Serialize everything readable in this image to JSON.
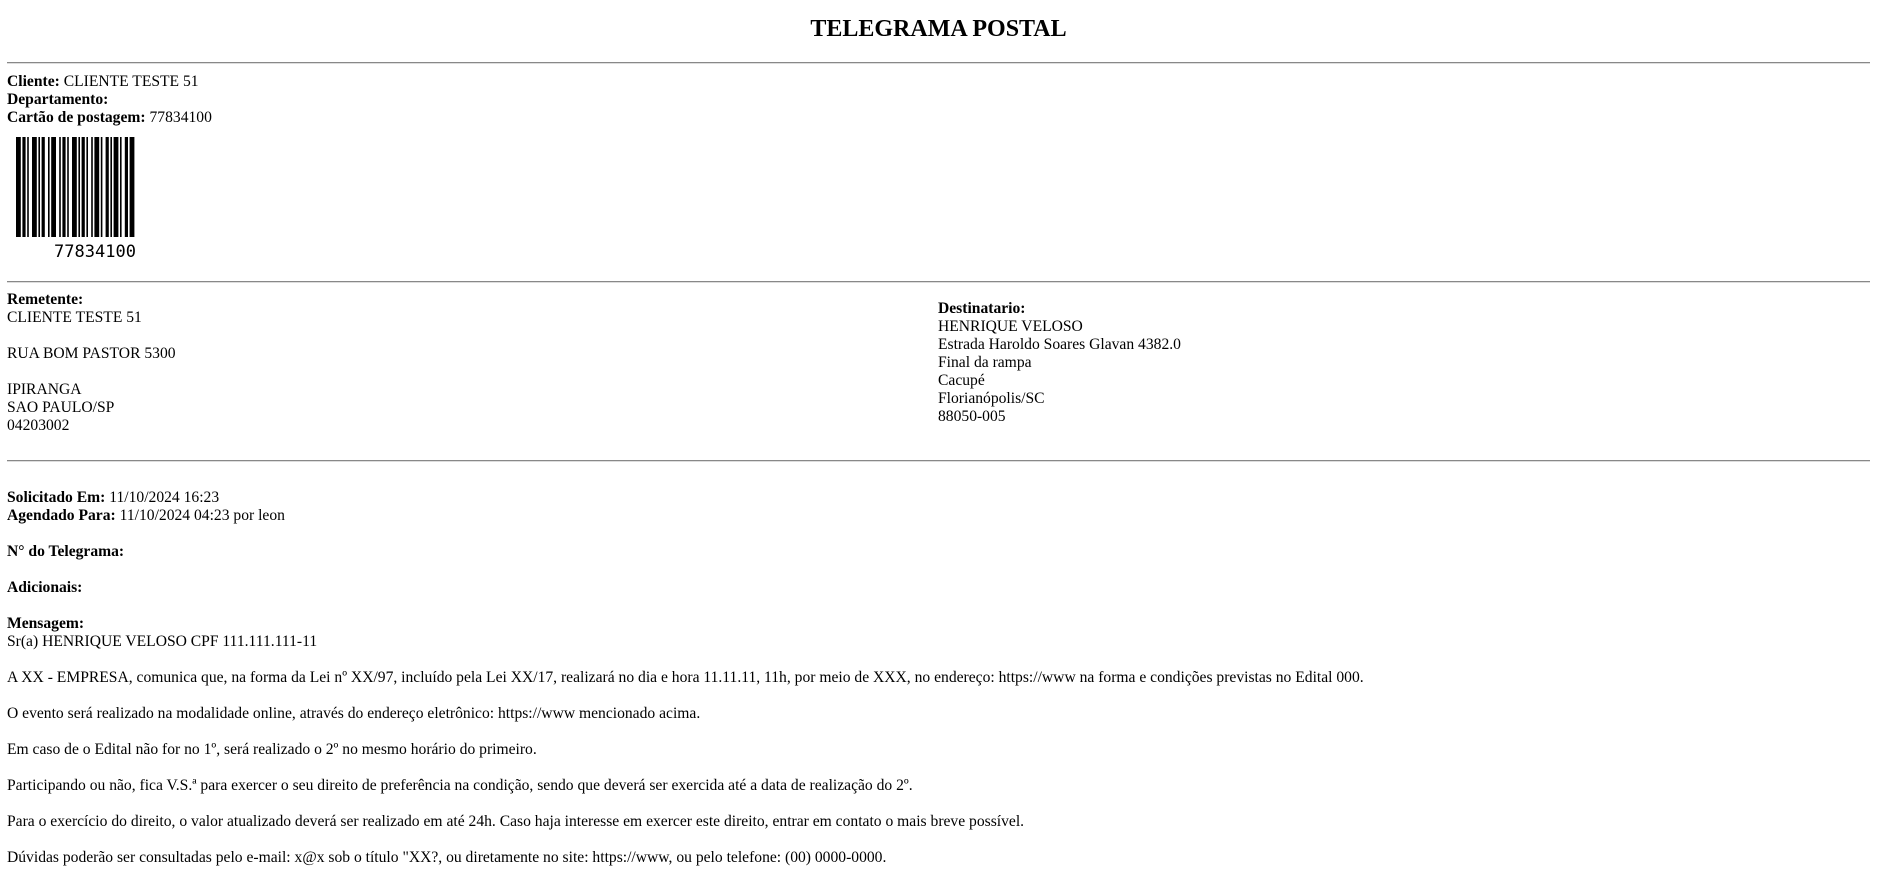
{
  "title": "TELEGRAMA POSTAL",
  "client": {
    "cliente_label": "Cliente:",
    "cliente_value": "CLIENTE TESTE 51",
    "departamento_label": "Departamento:",
    "departamento_value": "",
    "cartao_label": "Cartão de postagem:",
    "cartao_value": "77834100"
  },
  "barcode": {
    "number": "77834100"
  },
  "remetente": {
    "label": "Remetente:",
    "name": "CLIENTE TESTE 51",
    "street": "RUA BOM PASTOR 5300",
    "district": "IPIRANGA",
    "city": "SAO PAULO/SP",
    "zip": "04203002"
  },
  "destinatario": {
    "label": "Destinatario:",
    "name": "HENRIQUE VELOSO",
    "street": "Estrada Haroldo Soares Glavan 4382.0",
    "complement": "Final da rampa",
    "district": "Cacupé",
    "city": "Florianópolis/SC",
    "zip": "88050-005"
  },
  "details": {
    "solicitado_label": "Solicitado Em:",
    "solicitado_value": "11/10/2024 16:23",
    "agendado_label": "Agendado Para:",
    "agendado_value": "11/10/2024 04:23 por leon",
    "numero_label": "N° do Telegrama:",
    "adicionais_label": "Adicionais:",
    "mensagem_label": "Mensagem:"
  },
  "message": {
    "greeting": "Sr(a) HENRIQUE VELOSO CPF 111.111.111-11",
    "paragraphs": [
      "A XX - EMPRESA, comunica que, na forma da Lei nº XX/97, incluído pela Lei XX/17, realizará no dia e hora 11.11.11, 11h, por meio de XXX, no endereço: https://www na forma e condições previstas no Edital 000.",
      "O evento será realizado na modalidade online, através do endereço eletrônico: https://www mencionado acima.",
      "Em caso de o Edital não for no 1º, será realizado o 2º no mesmo horário do primeiro.",
      "Participando ou não, fica V.S.ª para exercer o seu direito de preferência na condição, sendo que deverá ser exercida até a data de realização do 2º.",
      "Para o exercício do direito, o valor atualizado deverá ser realizado em até 24h. Caso haja interesse em exercer este direito, entrar em contato o mais breve possível.",
      "Dúvidas poderão ser consultadas pelo e-mail: x@x sob o título \"XX?, ou diretamente no site: https://www, ou pelo telefone: (00) 0000-0000."
    ]
  }
}
